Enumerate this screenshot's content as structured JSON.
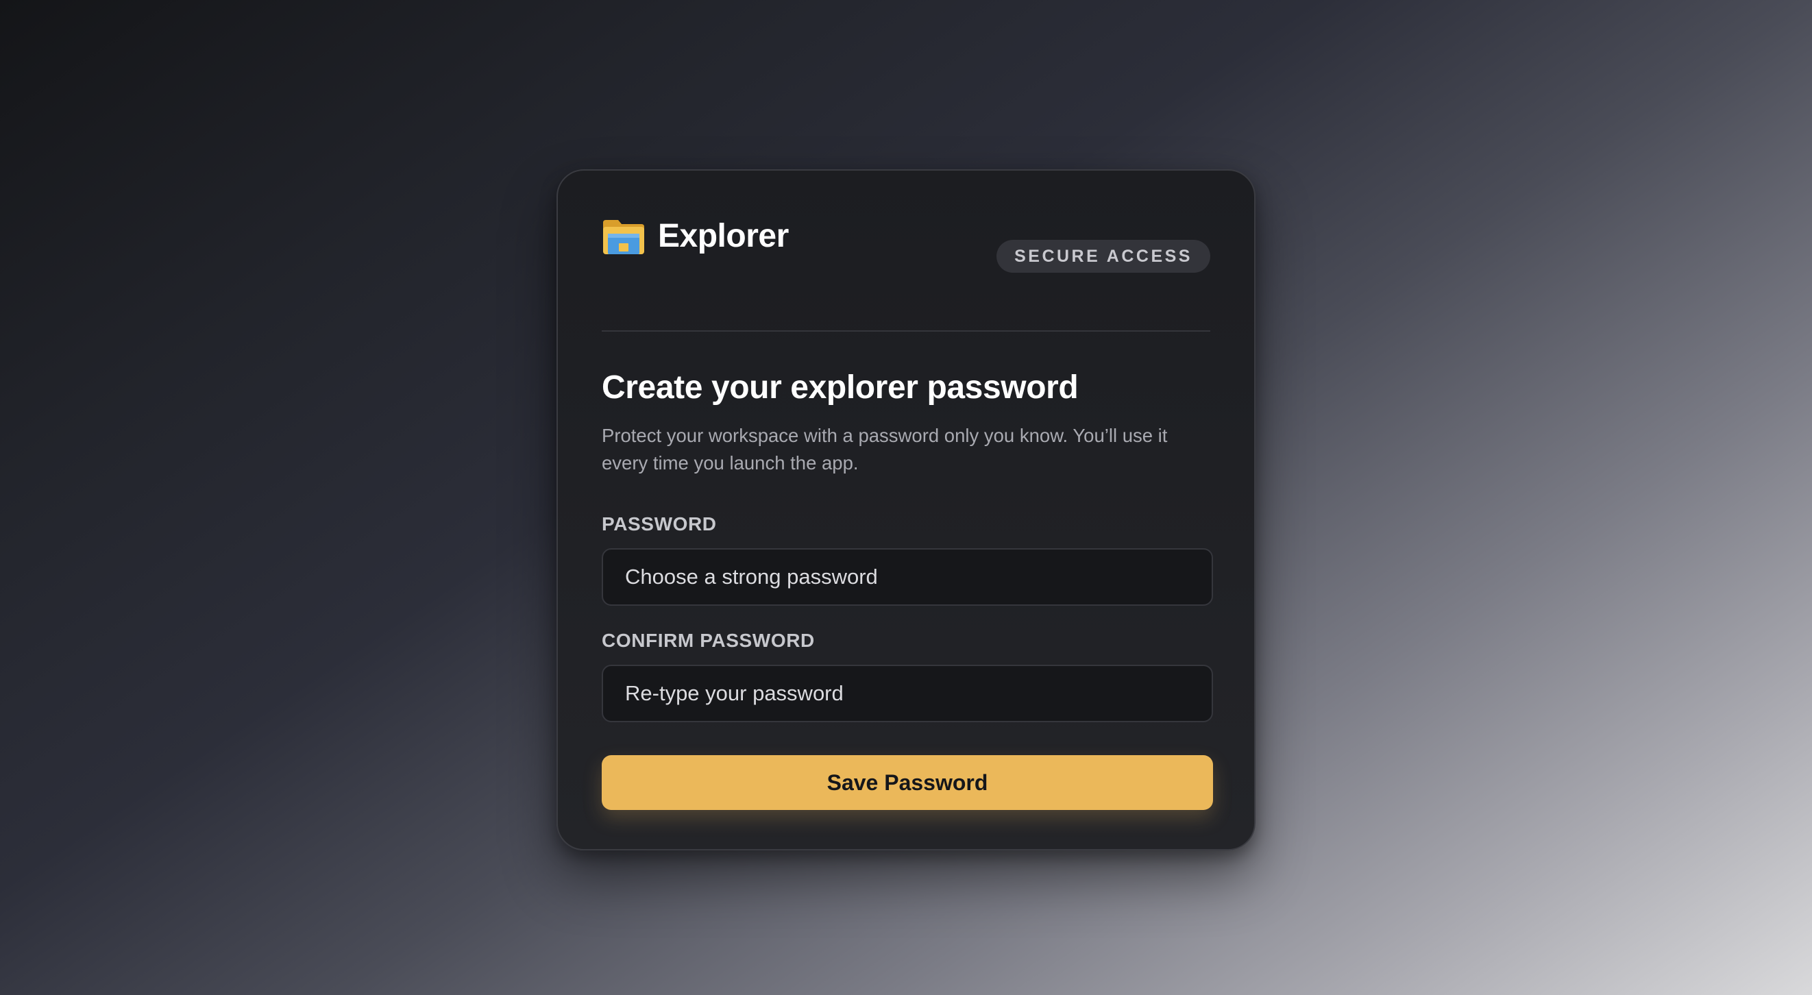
{
  "app": {
    "title": "Explorer",
    "icon": "folder-icon",
    "badge": "SECURE ACCESS"
  },
  "form": {
    "heading": "Create your explorer password",
    "description": "Protect your workspace with a password only you know. You’ll use it every time you launch the app.",
    "password": {
      "label": "PASSWORD",
      "value": "",
      "placeholder": "Choose a strong password"
    },
    "confirm": {
      "label": "CONFIRM PASSWORD",
      "value": "",
      "placeholder": "Re-type your password"
    },
    "submit_label": "Save Password"
  },
  "colors": {
    "accent": "#ebb85a",
    "card_background": "#1e1f23",
    "input_background": "#16171a",
    "folder_body": "#f2c24c",
    "folder_inner": "#4a9be0"
  }
}
